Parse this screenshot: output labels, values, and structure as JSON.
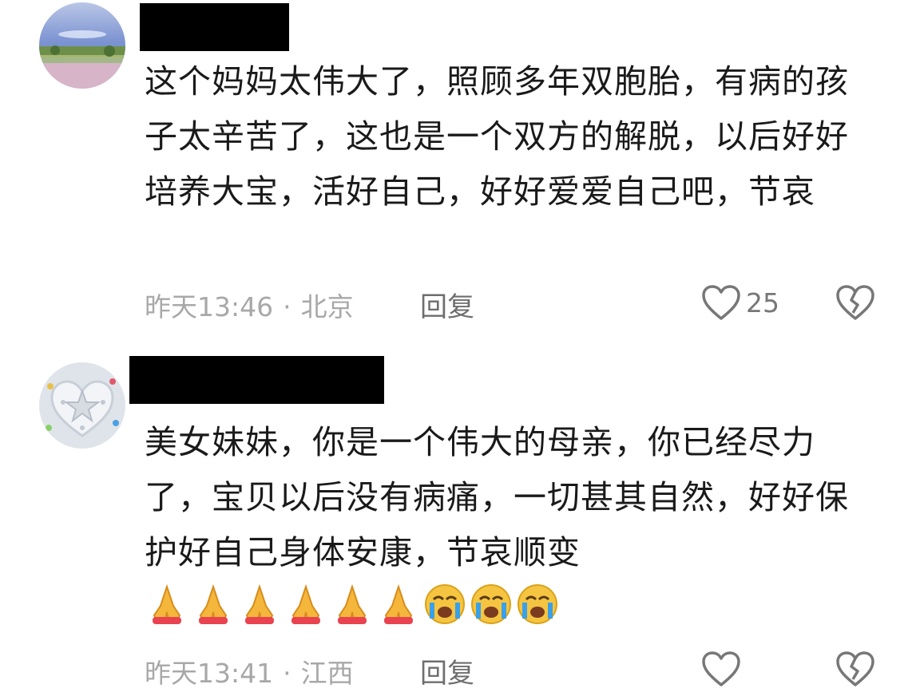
{
  "comments": [
    {
      "text": "这个妈妈太伟大了，照顾多年双胞胎，有病的孩子太辛苦了，这也是一个双方的解脱，以后好好培养大宝，活好自己，好好爱爱自己吧，节哀",
      "time": "昨天13:46",
      "separator": "·",
      "location": "北京",
      "reply_label": "回复",
      "like_count": "25",
      "avatar_icon": "landscape-avatar-icon",
      "like_icon": "heart-outline-icon",
      "dislike_icon": "broken-heart-icon"
    },
    {
      "text_main": "美女妹妹，你是一个伟大的母亲，你已经尽力了，宝贝以后没有病痛，一切甚其自然，好好保护好自己身体安康，节哀顺变",
      "emojis": [
        "folded-hands-icon",
        "folded-hands-icon",
        "folded-hands-icon",
        "folded-hands-icon",
        "folded-hands-icon",
        "folded-hands-icon",
        "crying-face-icon",
        "crying-face-icon",
        "crying-face-icon"
      ],
      "time": "昨天13:41",
      "separator": "·",
      "location": "江西",
      "reply_label": "回复",
      "like_count": "",
      "avatar_icon": "heart-star-avatar-icon",
      "like_icon": "heart-outline-icon",
      "dislike_icon": "broken-heart-icon"
    }
  ],
  "colors": {
    "text": "#1a1a1a",
    "meta": "#a8a8a8",
    "icon": "#777777",
    "redaction": "#000000"
  }
}
